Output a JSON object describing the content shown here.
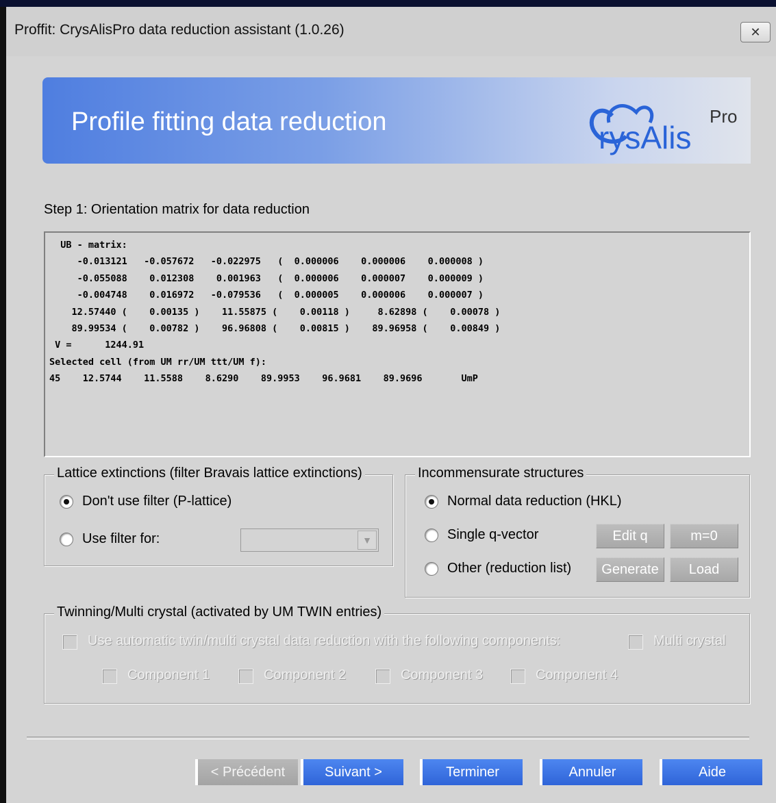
{
  "window": {
    "title": "Proffit: CrysAlisPro data reduction assistant (1.0.26)",
    "close_glyph": "✕"
  },
  "banner": {
    "title": "Profile fitting data reduction",
    "logo_text": "rysAlis",
    "logo_super": "Pro"
  },
  "step": {
    "label": "Step 1: Orientation matrix for data reduction"
  },
  "matrix_lines": [
    "  UB - matrix:",
    "     -0.013121   -0.057672   -0.022975   (  0.000006    0.000006    0.000008 )",
    "     -0.055088    0.012308    0.001963   (  0.000006    0.000007    0.000009 )",
    "     -0.004748    0.016972   -0.079536   (  0.000005    0.000006    0.000007 )",
    "    12.57440 (    0.00135 )    11.55875 (    0.00118 )     8.62898 (    0.00078 )",
    "    89.99534 (    0.00782 )    96.96808 (    0.00815 )    89.96958 (    0.00849 )",
    " V =      1244.91",
    "Selected cell (from UM rr/UM ttt/UM f):",
    "45    12.5744    11.5588    8.6290    89.9953    96.9681    89.9696       UmP"
  ],
  "lattice": {
    "title": "Lattice extinctions (filter Bravais lattice extinctions)",
    "option_no_filter": "Don't use filter (P-lattice)",
    "option_filter": "Use filter for:",
    "filter_value": "",
    "selected": "no_filter"
  },
  "incommensurate": {
    "title": "Incommensurate structures",
    "option_normal": "Normal data reduction (HKL)",
    "option_single": "Single q-vector",
    "option_other": "Other (reduction list)",
    "edit_q": "Edit q",
    "m0": "m=0",
    "generate": "Generate",
    "load": "Load",
    "selected": "normal"
  },
  "twinning": {
    "title": "Twinning/Multi crystal (activated by UM TWIN entries)",
    "auto_label": "Use automatic twin/multi crystal data reduction with the following components:",
    "multi_label": "Multi crystal",
    "components": [
      "Component 1",
      "Component 2",
      "Component 3",
      "Component 4"
    ]
  },
  "nav": {
    "prev": "< Précédent",
    "next": "Suivant >",
    "finish": "Terminer",
    "cancel": "Annuler",
    "help": "Aide"
  },
  "colors": {
    "banner_start": "#4f7ee0",
    "button_blue": "#2f64d8",
    "logo_blue": "#2a64d8"
  }
}
